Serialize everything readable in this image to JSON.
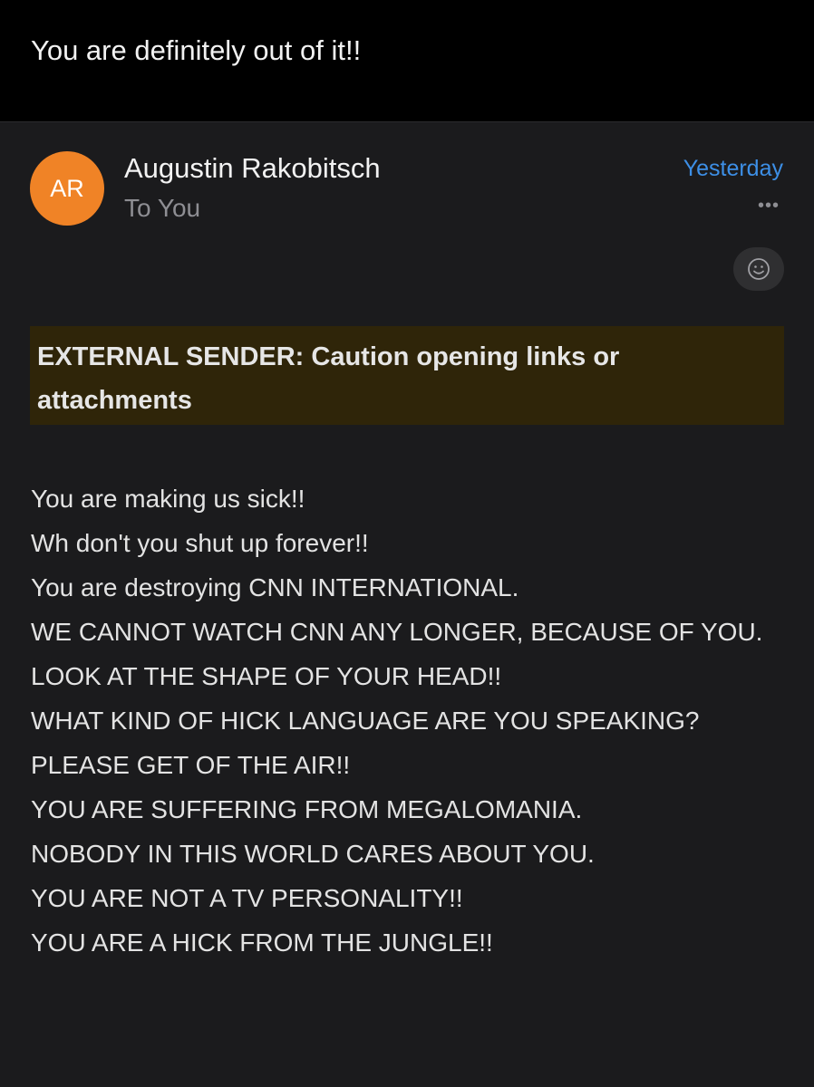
{
  "email": {
    "subject": "You are definitely out of it!!",
    "sender": {
      "initials": "AR",
      "name": "Augustin Rakobitsch",
      "avatar_color": "#f08326"
    },
    "recipient": "To You",
    "date": "Yesterday",
    "more_icon": "ellipsis-icon",
    "react_icon": "smiley-icon",
    "external_banner": "EXTERNAL SENDER: Caution opening links or attachments",
    "body_lines": [
      "You are making us sick!!",
      "Wh don't you shut up forever!!",
      "You are destroying CNN INTERNATIONAL.",
      "WE CANNOT WATCH CNN ANY LONGER, BECAUSE OF YOU.",
      "LOOK AT THE SHAPE OF YOUR HEAD!!",
      "WHAT KIND OF HICK LANGUAGE ARE YOU SPEAKING?",
      "PLEASE GET OF THE AIR!!",
      "YOU ARE SUFFERING FROM MEGALOMANIA.",
      "NOBODY IN THIS WORLD CARES ABOUT YOU.",
      "YOU ARE NOT A TV PERSONALITY!!",
      "YOU ARE A HICK FROM THE JUNGLE!!"
    ]
  },
  "colors": {
    "date_link": "#3d8fe6",
    "banner_background": "#2f2509",
    "background": "#1b1b1d",
    "header_background": "#000000"
  }
}
